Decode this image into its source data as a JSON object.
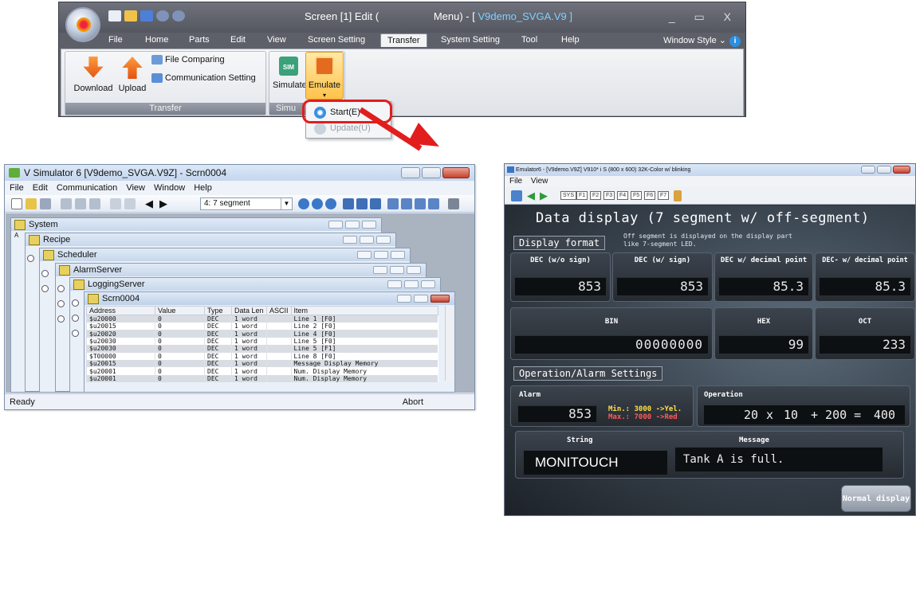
{
  "ribbon": {
    "title_prefix": "Screen [1] Edit (",
    "title_menu": "Menu) - [",
    "title_file": " V9demo_SVGA.V9 ]",
    "window_controls": "_ ▭ X",
    "tabs": [
      "File",
      "Home",
      "Parts",
      "Edit",
      "View",
      "Screen Setting",
      "Transfer",
      "System Setting",
      "Tool",
      "Help"
    ],
    "active_tab": "Transfer",
    "window_style": "Window Style",
    "info_icon": "i",
    "groups": {
      "transfer": {
        "label": "Transfer",
        "download": "Download",
        "upload": "Upload",
        "file_comparing": "File Comparing",
        "communication_setting": "Communication Setting"
      },
      "simulation": {
        "label": "Simu",
        "simulate": "Simulate",
        "emulate": "Emulate",
        "sim_badge": "SIM"
      }
    },
    "dropdown": {
      "start": "Start(E)",
      "update": "Update(U)"
    }
  },
  "vsim": {
    "title": "V Simulator 6 [V9demo_SVGA.V9Z] - Scrn0004",
    "menu": [
      "File",
      "Edit",
      "Communication",
      "View",
      "Window",
      "Help"
    ],
    "combo_value": "4:   7 segment",
    "windows": [
      "System",
      "Recipe",
      "Scheduler",
      "AlarmServer",
      "LoggingServer",
      "Scrn0004"
    ],
    "columns": [
      "Address",
      "Value",
      "Type",
      "Data Len",
      "ASCII",
      "Item"
    ],
    "rows": [
      [
        "$u20000",
        "0",
        "DEC",
        "1 word",
        "",
        "Line 1 [F0]"
      ],
      [
        "$u20015",
        "0",
        "DEC",
        "1 word",
        "",
        "Line 2 [F0]"
      ],
      [
        "$u20020",
        "0",
        "DEC",
        "1 word",
        "",
        "Line 4 [F0]"
      ],
      [
        "$u20030",
        "0",
        "DEC",
        "1 word",
        "",
        "Line 5 [F0]"
      ],
      [
        "$u20030",
        "0",
        "DEC",
        "1 word",
        "",
        "Line 5 [F1]"
      ],
      [
        "$T00000",
        "0",
        "DEC",
        "1 word",
        "",
        "Line 8 [F0]"
      ],
      [
        "$u20015",
        "0",
        "DEC",
        "1 word",
        "",
        "Message Display Memory"
      ],
      [
        "$u20001",
        "0",
        "DEC",
        "1 word",
        "",
        "Num. Display Memory"
      ],
      [
        "$u20001",
        "0",
        "DEC",
        "1 word",
        "",
        "Num. Display Memory"
      ]
    ],
    "status_left": "Ready",
    "status_right": "Abort"
  },
  "emu": {
    "title": "Emulator6 - [V9demo.V9Z] V910* i S (800 x 600) 32K-Color w/ blinking",
    "menu": [
      "File",
      "View"
    ],
    "fkeys": [
      "SYS",
      "F1",
      "F2",
      "F3",
      "F4",
      "F5",
      "F6",
      "F7"
    ],
    "screen_title": "Data display (7 segment w/ off-segment)",
    "display_format": "Display format",
    "note_line1": "Off segment is displayed on the display part",
    "note_line2": "like 7-segment LED.",
    "dec_heads": [
      "DEC (w/o sign)",
      "DEC (w/ sign)",
      "DEC w/ decimal point",
      "DEC- w/ decimal point"
    ],
    "dec_values": [
      "853",
      "853",
      "85.3",
      "85.3"
    ],
    "bin_head": "BIN",
    "bin_value": "00000000",
    "hex_head": "HEX",
    "hex_value": "99",
    "oct_head": "OCT",
    "oct_value": "233",
    "op_settings": "Operation/Alarm Settings",
    "alarm_head": "Alarm",
    "alarm_value": "853",
    "alarm_min": "Min.: 3000  ->Yel.",
    "alarm_max": "Max.: 7000  ->Red",
    "operation_head": "Operation",
    "op_a": "20",
    "op_x": "x",
    "op_b": "10",
    "op_plus": "+ 200 =",
    "op_result": "400",
    "string_head": "String",
    "string_value": "MONITOUCH",
    "message_head": "Message",
    "message_value": "Tank A is full.",
    "normal_display": "Normal display"
  },
  "colors": {
    "highlight_red": "#e21d1d",
    "ribbon_dark": "#5d6069"
  }
}
